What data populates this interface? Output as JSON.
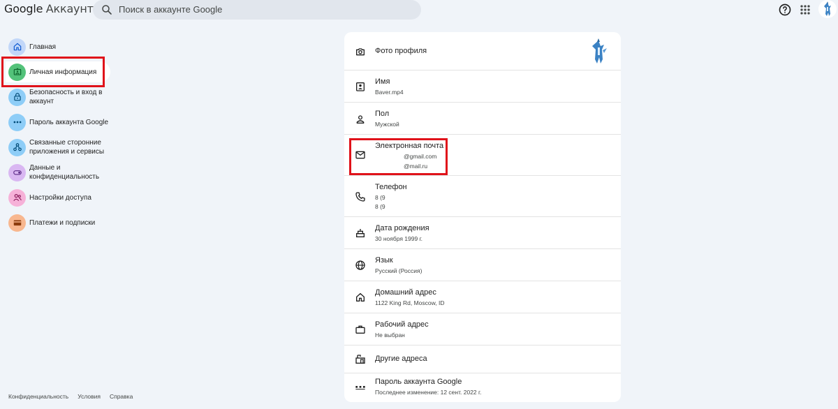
{
  "header": {
    "brand_google": "Google",
    "brand_account": "Аккаунт",
    "search_placeholder": "Поиск в аккаунте Google",
    "help_icon": "help-icon",
    "apps_icon": "apps-grid-icon"
  },
  "sidebar": {
    "items": [
      {
        "label": "Главная",
        "icon": "home-icon",
        "color": "#c2d7f9"
      },
      {
        "label": "Личная информация",
        "icon": "id-card-icon",
        "color": "#53c27a"
      },
      {
        "label": "Безопасность и вход в аккаунт",
        "icon": "lock-icon",
        "color": "#8ecdf7"
      },
      {
        "label": "Пароль аккаунта Google",
        "icon": "password-icon",
        "color": "#8ecdf7"
      },
      {
        "label": "Связанные сторонние приложения и сервисы",
        "icon": "connected-apps-icon",
        "color": "#8ecdf7"
      },
      {
        "label": "Данные и конфиденциальность",
        "icon": "toggle-icon",
        "color": "#d9b7f2"
      },
      {
        "label": "Настройки доступа",
        "icon": "people-icon",
        "color": "#f6b1d8"
      },
      {
        "label": "Платежи и подписки",
        "icon": "credit-card-icon",
        "color": "#f8b78f"
      }
    ],
    "active_index": 1
  },
  "footer": {
    "links": [
      "Конфиденциальность",
      "Условия",
      "Справка"
    ]
  },
  "profile": {
    "rows": [
      {
        "title": "Фото профиля",
        "values": [],
        "icon": "camera-icon"
      },
      {
        "title": "Имя",
        "values": [
          "Baver.mp4"
        ],
        "icon": "badge-icon"
      },
      {
        "title": "Пол",
        "values": [
          "Мужской"
        ],
        "icon": "person-icon"
      },
      {
        "title": "Электронная почта",
        "values": [
          "@gmail.com",
          "@mail.ru"
        ],
        "icon": "mail-icon"
      },
      {
        "title": "Телефон",
        "values": [
          "8 (9",
          "8 (9"
        ],
        "icon": "phone-icon"
      },
      {
        "title": "Дата рождения",
        "values": [
          "30 ноября 1999 г."
        ],
        "icon": "cake-icon"
      },
      {
        "title": "Язык",
        "values": [
          "Русский (Россия)"
        ],
        "icon": "globe-icon"
      },
      {
        "title": "Домашний адрес",
        "values": [
          "1122 King Rd, Moscow, ID"
        ],
        "icon": "home-address-icon"
      },
      {
        "title": "Рабочий адрес",
        "values": [
          "Не выбран"
        ],
        "icon": "work-icon"
      },
      {
        "title": "Другие адреса",
        "values": [],
        "icon": "location-icon"
      },
      {
        "title": "Пароль аккаунта Google",
        "values": [
          "Последнее изменение: 12 сент. 2022 г."
        ],
        "icon": "password-dots-icon"
      }
    ]
  },
  "colors": {
    "background": "#f0f4f9",
    "highlight": "#e0121a",
    "card": "#ffffff"
  }
}
